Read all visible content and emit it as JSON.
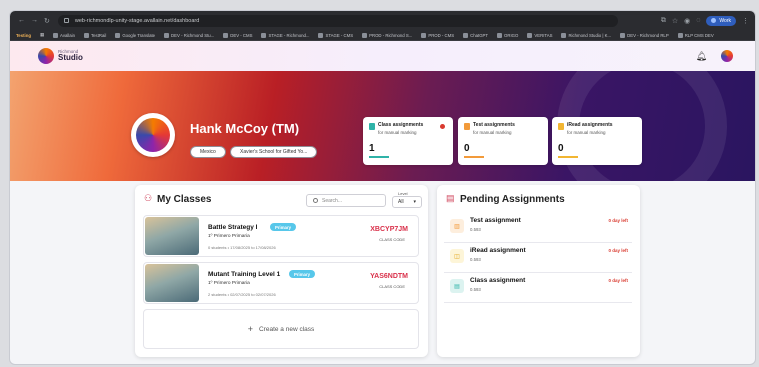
{
  "browser": {
    "url": "web-richmondlp-unity-stage.avallain.net/dashboard",
    "profile_label": "Work",
    "bookmarks": [
      "Testing",
      "Avallain",
      "TestRail",
      "Google Translate",
      "DEV - Richmond Stu...",
      "DEV - CMS",
      "STAGE - Richmond...",
      "STAGE - CMS",
      "PROD - Richmond S...",
      "PROD - CMS",
      "ChatGPT",
      "ORIGO",
      "VERITAS",
      "Richmond Studio | K...",
      "DEV - Richmond RLP",
      "RLP CMS DEV"
    ]
  },
  "header": {
    "logo_small": "Richmond",
    "logo_big": "Studio"
  },
  "profile": {
    "name": "Hank McCoy (TM)",
    "country": "Mexico",
    "school": "Xavier's School for Gifted Yo..."
  },
  "stats": [
    {
      "title": "Class assignments",
      "sub": "for manual marking",
      "value": "1",
      "color": "#2fb3a8"
    },
    {
      "title": "Test assignments",
      "sub": "for manual marking",
      "value": "0",
      "color": "#f29a3a"
    },
    {
      "title": "iRead assignments",
      "sub": "for manual marking",
      "value": "0",
      "color": "#f2b632"
    }
  ],
  "my_classes": {
    "title": "My Classes",
    "search_placeholder": "Search...",
    "level_label": "Level",
    "level_value": "All",
    "classes": [
      {
        "name": "Battle Strategy I",
        "badge": "Primary",
        "grade": "1º Primero Primaria",
        "meta": "0 students • 17/08/2025 to 17/08/2026",
        "code": "XBCYP7JM",
        "code_label": "CLASS CODE"
      },
      {
        "name": "Mutant Training Level 1",
        "badge": "Primary",
        "grade": "1º Primero Primaria",
        "meta": "2 students • 02/07/2025 to 02/07/2026",
        "code": "YAS6NDTM",
        "code_label": "CLASS CODE"
      }
    ],
    "create_label": "Create a new class"
  },
  "pending": {
    "title": "Pending Assignments",
    "items": [
      {
        "title": "Test assignment",
        "sub": "0.593",
        "due": "0 day left",
        "icon_color": "#f29a3a",
        "icon_bg": "#fdeedd"
      },
      {
        "title": "iRead assignment",
        "sub": "0.593",
        "due": "0 day left",
        "icon_color": "#e0a416",
        "icon_bg": "#fdf5d8"
      },
      {
        "title": "Class assignment",
        "sub": "0.593",
        "due": "0 day left",
        "icon_color": "#2fb3a8",
        "icon_bg": "#dcf3f0"
      }
    ]
  }
}
